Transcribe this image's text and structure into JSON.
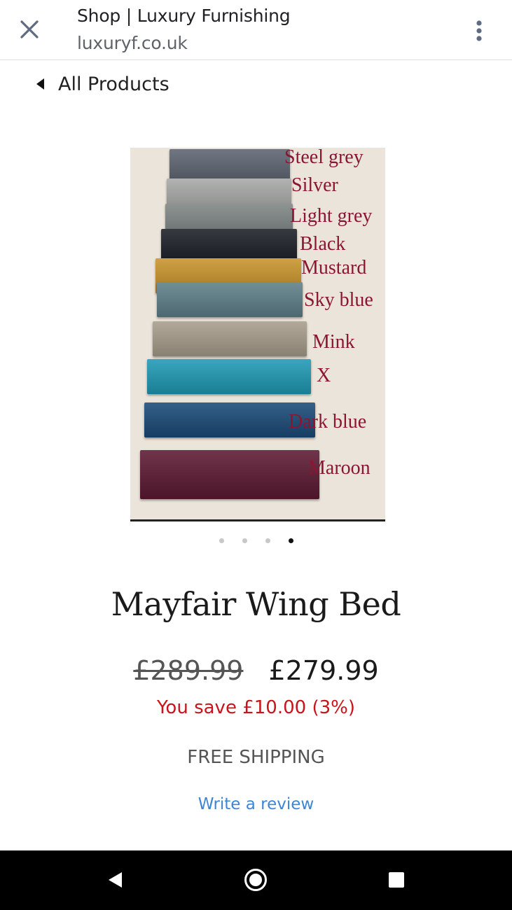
{
  "browser": {
    "title": "Shop | Luxury Furnishing",
    "url": "luxuryf.co.uk",
    "close_icon": "close-icon",
    "menu_icon": "more-vertical-icon"
  },
  "nav": {
    "back_label": "All Products",
    "back_icon": "caret-left-icon"
  },
  "product_image": {
    "swatches": [
      {
        "label": "Steel grey",
        "color": "#5c6470"
      },
      {
        "label": "Silver",
        "color": "#a6a8a6"
      },
      {
        "label": "Light grey",
        "color": "#7e8583"
      },
      {
        "label": "Black",
        "color": "#1b1e26"
      },
      {
        "label": "Mustard",
        "color": "#c9942a"
      },
      {
        "label": "Sky blue",
        "color": "#5e7f88"
      },
      {
        "label": "Mink",
        "color": "#a79d8b"
      },
      {
        "label": "X",
        "color": "#1e9ab4"
      },
      {
        "label": "Dark blue",
        "color": "#1a4a78"
      },
      {
        "label": "Maroon",
        "color": "#5c1932"
      }
    ]
  },
  "carousel": {
    "total": 4,
    "active_index": 3
  },
  "product": {
    "title": "Mayfair Wing Bed",
    "price_old": "£289.99",
    "price_new": "£279.99",
    "savings": "You save £10.00 (3%)",
    "shipping": "FREE SHIPPING",
    "review_link": "Write a review"
  },
  "system_nav": {
    "back_icon": "back-triangle-icon",
    "home_icon": "home-circle-icon",
    "recents_icon": "recents-square-icon"
  },
  "colors": {
    "savings": "#c8151b",
    "link": "#3d86d6",
    "swatch_label": "#8a1633"
  }
}
